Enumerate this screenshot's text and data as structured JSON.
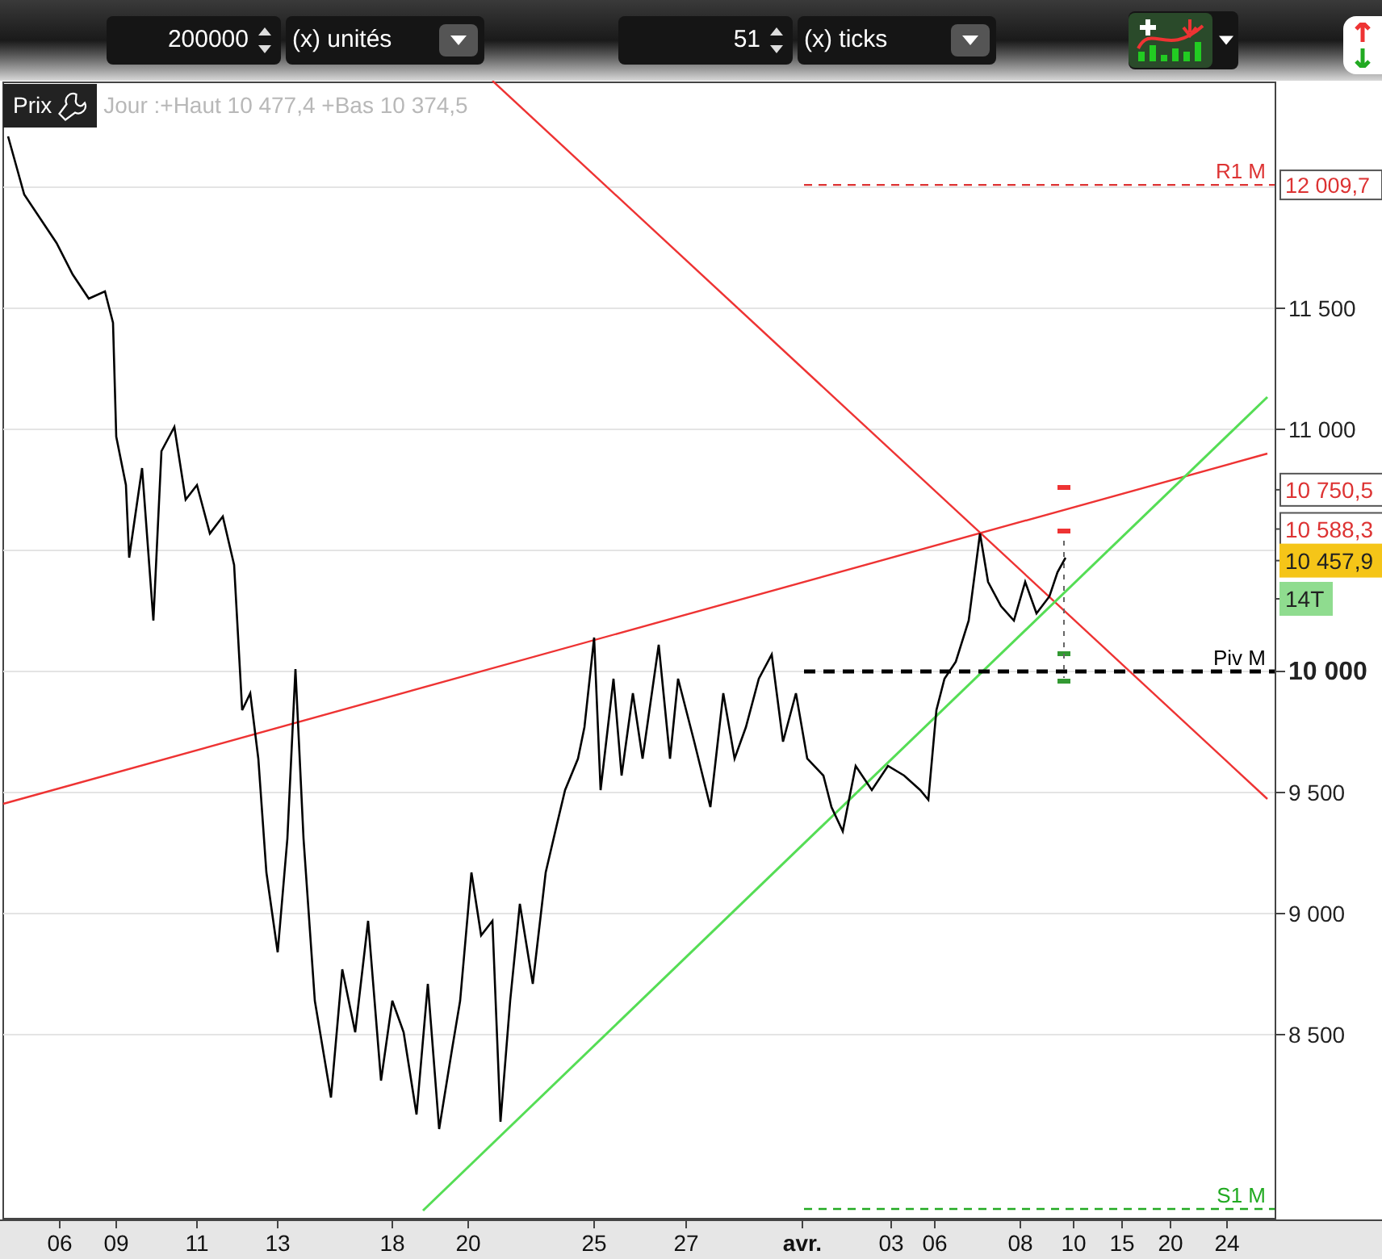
{
  "toolbar": {
    "quantity": {
      "value": "200000",
      "unit": "(x) unités"
    },
    "ticks": {
      "value": "51",
      "unit": "(x) ticks"
    }
  },
  "chart_header": {
    "label": "Prix",
    "info": "Jour :+Haut 10 477,4 +Bas 10 374,5"
  },
  "levels": [
    {
      "label": "R1 M",
      "tag": "12 009,7",
      "color": "#dd3333"
    },
    {
      "label": "Piv M",
      "color": "#000000"
    },
    {
      "label": "S1 M",
      "color": "#22aa22"
    }
  ],
  "price_tags": [
    {
      "kind": "level",
      "text": "10 750,5"
    },
    {
      "kind": "level",
      "text": "10 588,3"
    },
    {
      "kind": "current",
      "text": "10 457,9"
    },
    {
      "kind": "timer",
      "text": "14T"
    }
  ],
  "y_axis_labels": [
    {
      "text": "11 500",
      "emphasis": false
    },
    {
      "text": "11 000",
      "emphasis": false
    },
    {
      "text": "10 000",
      "emphasis": true
    },
    {
      "text": "9 500",
      "emphasis": false
    },
    {
      "text": "9 000",
      "emphasis": false
    },
    {
      "text": "8 500",
      "emphasis": false
    }
  ],
  "x_axis_labels": [
    {
      "text": "06",
      "month": false
    },
    {
      "text": "09",
      "month": false
    },
    {
      "text": "11",
      "month": false
    },
    {
      "text": "13",
      "month": false
    },
    {
      "text": "18",
      "month": false
    },
    {
      "text": "20",
      "month": false
    },
    {
      "text": "25",
      "month": false
    },
    {
      "text": "27",
      "month": false
    },
    {
      "text": "avr.",
      "month": true
    },
    {
      "text": "03",
      "month": false
    },
    {
      "text": "06",
      "month": false
    },
    {
      "text": "08",
      "month": false
    },
    {
      "text": "10",
      "month": false
    },
    {
      "text": "15",
      "month": false
    },
    {
      "text": "20",
      "month": false
    },
    {
      "text": "24",
      "month": false
    }
  ]
}
